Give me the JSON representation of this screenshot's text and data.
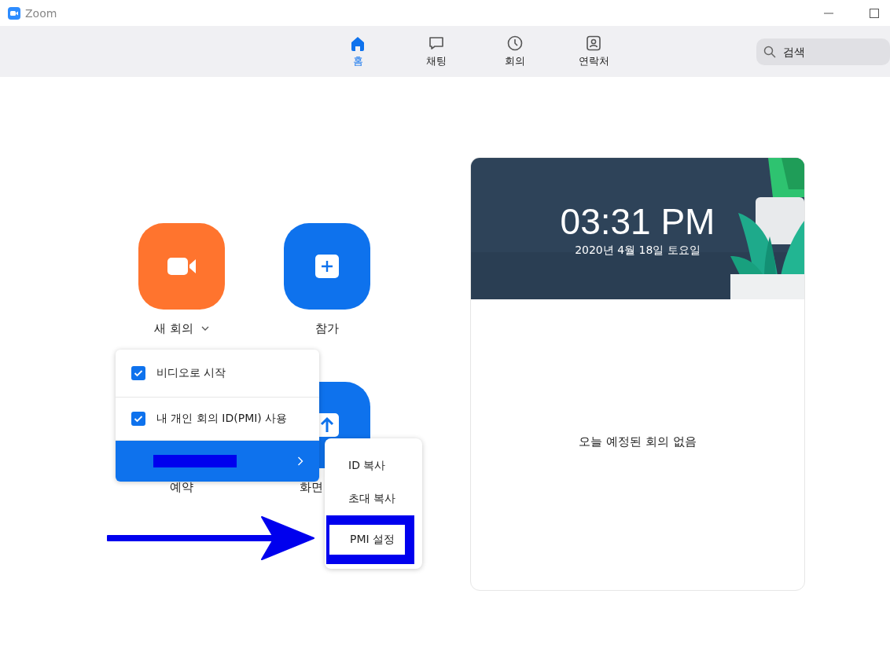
{
  "window": {
    "title": "Zoom"
  },
  "nav_tabs": [
    {
      "label": "홈",
      "selected": true
    },
    {
      "label": "채팅",
      "selected": false
    },
    {
      "label": "회의",
      "selected": false
    },
    {
      "label": "연락처",
      "selected": false
    }
  ],
  "search": {
    "placeholder": "검색"
  },
  "actions": [
    {
      "label": "새 회의",
      "dropdown": true
    },
    {
      "label": "참가",
      "dropdown": false
    },
    {
      "label": "예약",
      "dropdown": false
    },
    {
      "label": "화면",
      "dropdown": false
    }
  ],
  "new_meeting_menu": [
    {
      "kind": "checkbox",
      "label": "비디오로 시작",
      "checked": true,
      "selected": false
    },
    {
      "kind": "checkbox",
      "label": "내 개인 회의 ID(PMI) 사용",
      "checked": true,
      "selected": false
    },
    {
      "kind": "submenu",
      "redacted": true,
      "selected": true
    }
  ],
  "pmi_submenu": [
    {
      "label": "ID 복사",
      "outlined": false
    },
    {
      "label": "초대 복사",
      "outlined": false
    },
    {
      "label": "PMI 설정",
      "outlined": true
    }
  ],
  "annotations": [
    {
      "kind": "arrow"
    }
  ],
  "meeting_card": {
    "time": "03:31 PM",
    "date": "2020년 4월 18일 토요일",
    "empty_message": "오늘 예정된 회의 없음"
  }
}
